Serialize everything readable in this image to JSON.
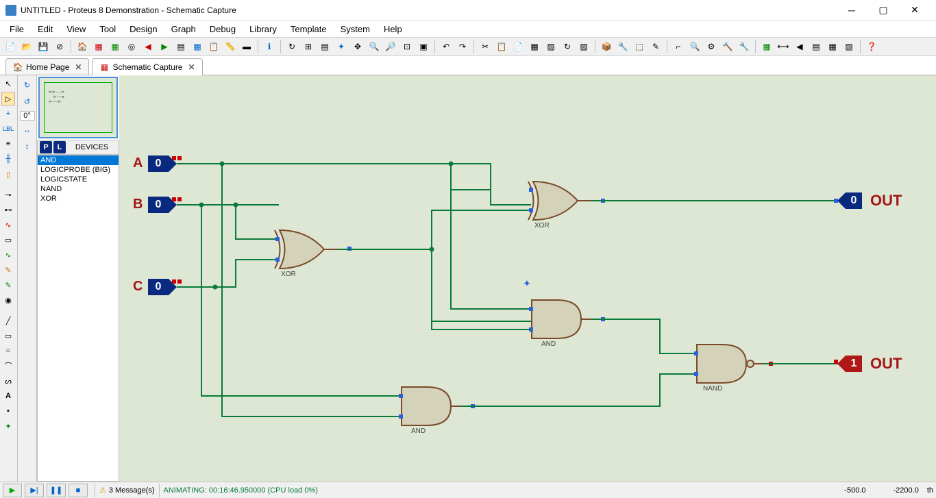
{
  "window": {
    "title": "UNTITLED - Proteus 8 Demonstration - Schematic Capture"
  },
  "menu": [
    "File",
    "Edit",
    "View",
    "Tool",
    "Design",
    "Graph",
    "Debug",
    "Library",
    "Template",
    "System",
    "Help"
  ],
  "tabs": {
    "home": "Home Page",
    "schematic": "Schematic Capture"
  },
  "rotation": "0°",
  "devices": {
    "header": "DEVICES",
    "items": [
      "AND",
      "LOGICPROBE (BIG)",
      "LOGICSTATE",
      "NAND",
      "XOR"
    ],
    "selected_index": 0
  },
  "schematic": {
    "inputs": {
      "A": {
        "label": "A",
        "value": "0"
      },
      "B": {
        "label": "B",
        "value": "0"
      },
      "C": {
        "label": "C",
        "value": "0"
      }
    },
    "gates": {
      "xor1": "XOR",
      "xor2": "XOR",
      "and1": "AND",
      "and2": "AND",
      "nand": "NAND"
    },
    "outputs": {
      "sum": {
        "label": "OUT",
        "value": "0"
      },
      "carry": {
        "label": "OUT",
        "value": "1"
      }
    }
  },
  "status": {
    "messages": "3 Message(s)",
    "anim": "ANIMATING: 00:16:46.950000 (CPU load 0%)",
    "coord_x": "-500.0",
    "coord_y": "-2200.0",
    "unit": "th"
  }
}
